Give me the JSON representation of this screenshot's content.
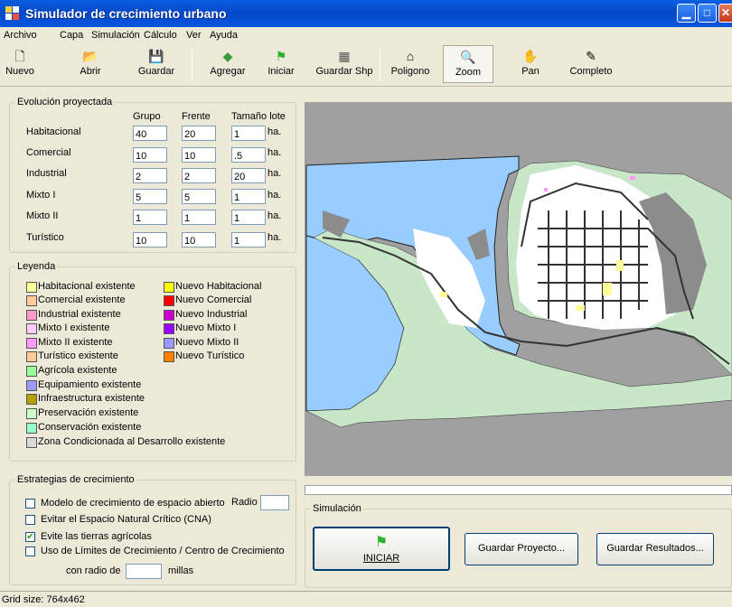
{
  "window": {
    "title": "Simulador de crecimiento urbano"
  },
  "menu": [
    "Archivo",
    "Capa",
    "Simulación",
    "Cálculo",
    "Ver",
    "Ayuda"
  ],
  "toolbar": [
    {
      "label": "Nuevo",
      "icon": "new-file-icon",
      "glyph": "🗋"
    },
    {
      "label": "Abrir",
      "icon": "open-folder-icon",
      "glyph": "📂"
    },
    {
      "label": "Guardar",
      "icon": "save-disk-icon",
      "glyph": "💾"
    },
    {
      "label": "Agregar",
      "icon": "add-layer-icon",
      "glyph": "◆"
    },
    {
      "label": "Iniciar",
      "icon": "green-flag-icon",
      "glyph": "⚑"
    },
    {
      "label": "Guardar Shp",
      "icon": "save-shapefile-icon",
      "glyph": "▦"
    },
    {
      "label": "Poligono",
      "icon": "polygon-icon",
      "glyph": "⌂"
    },
    {
      "label": "Zoom",
      "icon": "magnifier-icon",
      "glyph": "🔍"
    },
    {
      "label": "Pan",
      "icon": "hand-icon",
      "glyph": "✋"
    },
    {
      "label": "Completo",
      "icon": "full-extent-icon",
      "glyph": "✎"
    }
  ],
  "evolution": {
    "title": "Evolución proyectada",
    "headers": {
      "grupo": "Grupo",
      "frente": "Frente",
      "lote": "Tamaño lote"
    },
    "unit": "ha.",
    "rows": [
      {
        "label": "Habitacional",
        "grupo": "40",
        "frente": "20",
        "lote": "1"
      },
      {
        "label": "Comercial",
        "grupo": "10",
        "frente": "10",
        "lote": ".5"
      },
      {
        "label": "Industrial",
        "grupo": "2",
        "frente": "2",
        "lote": "20"
      },
      {
        "label": "Mixto I",
        "grupo": "5",
        "frente": "5",
        "lote": "1"
      },
      {
        "label": "Mixto II",
        "grupo": "1",
        "frente": "1",
        "lote": "1"
      },
      {
        "label": "Turístico",
        "grupo": "10",
        "frente": "10",
        "lote": "1"
      }
    ]
  },
  "legend": {
    "title": "Leyenda",
    "left": [
      {
        "label": "Habitacional existente",
        "color": "#ffff99"
      },
      {
        "label": "Comercial existente",
        "color": "#ffcc99"
      },
      {
        "label": "Industrial existente",
        "color": "#ff99cc"
      },
      {
        "label": "Mixto I existente",
        "color": "#ffccff"
      },
      {
        "label": "Mixto II existente",
        "color": "#ff99ff"
      },
      {
        "label": "Turístico existente",
        "color": "#ffcc99"
      },
      {
        "label": "Agrícola existente",
        "color": "#99ff99"
      },
      {
        "label": "Equipamiento existente",
        "color": "#9999ff"
      },
      {
        "label": "Infraestructura existente",
        "color": "#b3a300"
      },
      {
        "label": "Preservación existente",
        "color": "#ccffcc"
      },
      {
        "label": "Conservación existente",
        "color": "#99ffcc"
      },
      {
        "label": "Zona Condicionada al Desarrollo existente",
        "color": "#d9d9d9"
      }
    ],
    "right": [
      {
        "label": "Nuevo Habitacional",
        "color": "#ffff00"
      },
      {
        "label": "Nuevo Comercial",
        "color": "#ff0000"
      },
      {
        "label": "Nuevo Industrial",
        "color": "#cc00cc"
      },
      {
        "label": "Nuevo Mixto I",
        "color": "#9900ff"
      },
      {
        "label": "Nuevo Mixto II",
        "color": "#9999ff"
      },
      {
        "label": "Nuevo Turístico",
        "color": "#ff8000"
      }
    ]
  },
  "strategies": {
    "title": "Estrategias de crecimiento",
    "radio_label": "Radio",
    "radio_value": "",
    "options": [
      {
        "label": "Modelo de crecimiento de espacio abierto",
        "checked": false
      },
      {
        "label": "Evitar el Espacio Natural Crítico (CNA)",
        "checked": false
      },
      {
        "label": "Evite las tierras agrícolas",
        "checked": true
      },
      {
        "label": "Uso de Límites de Crecimiento / Centro de Crecimiento",
        "checked": false
      }
    ],
    "radius_prefix": "con radio de",
    "radius_value": "",
    "radius_unit": "millas"
  },
  "simulation": {
    "title": "Simulación",
    "start": "INICIAR",
    "save_project": "Guardar Proyecto...",
    "save_results": "Guardar Resultados..."
  },
  "status": "Grid size: 764x462",
  "colors": {
    "water": "#99ccff",
    "land": "#c8e6c8",
    "urban": "#ffffff",
    "nodata": "#a0a0a0",
    "grey_area": "#8c8c8c"
  }
}
